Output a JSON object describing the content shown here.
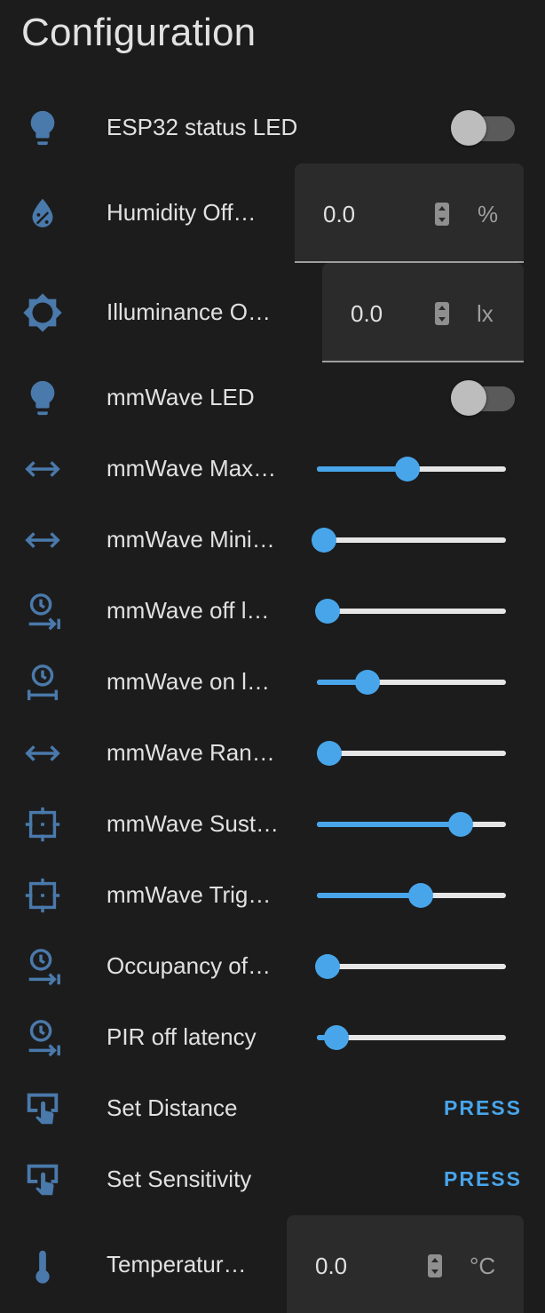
{
  "header": {
    "title": "Configuration"
  },
  "colors": {
    "background": "#1c1c1c",
    "accent": "#48a5ea",
    "icon": "#4a79ab",
    "text": "#e1e1e1"
  },
  "entities": {
    "esp32_led": {
      "label": "ESP32 status LED",
      "icon": "lightbulb-icon",
      "state": "off"
    },
    "humidity_offset": {
      "label": "Humidity Off…",
      "icon": "water-percent-icon",
      "value": "0.0",
      "unit": "%"
    },
    "illuminance_offset": {
      "label": "Illuminance O…",
      "icon": "brightness-icon",
      "value": "0.0",
      "unit": "lx"
    },
    "mmwave_led": {
      "label": "mmWave LED",
      "icon": "lightbulb-icon",
      "state": "off"
    },
    "mmwave_max": {
      "label": "mmWave Max…",
      "icon": "arrow-left-right-icon",
      "level": 0.48
    },
    "mmwave_min": {
      "label": "mmWave Mini…",
      "icon": "arrow-left-right-icon",
      "level": 0.02
    },
    "mmwave_off_latency": {
      "label": "mmWave off l…",
      "icon": "timer-arrow-icon",
      "level": 0.04
    },
    "mmwave_on_latency": {
      "label": "mmWave on l…",
      "icon": "timer-range-icon",
      "level": 0.26
    },
    "mmwave_range": {
      "label": "mmWave Ran…",
      "icon": "arrow-left-right-icon",
      "level": 0.05
    },
    "mmwave_sustain": {
      "label": "mmWave Sust…",
      "icon": "crosshair-box-icon",
      "level": 0.77
    },
    "mmwave_trigger": {
      "label": "mmWave Trig…",
      "icon": "crosshair-box-icon",
      "level": 0.55
    },
    "occupancy_off": {
      "label": "Occupancy of…",
      "icon": "timer-arrow-icon",
      "level": 0.04
    },
    "pir_off_latency": {
      "label": "PIR off latency",
      "icon": "timer-arrow-icon",
      "level": 0.09
    },
    "set_distance": {
      "label": "Set Distance",
      "icon": "gesture-tap-button-icon",
      "action": "PRESS"
    },
    "set_sensitivity": {
      "label": "Set Sensitivity",
      "icon": "gesture-tap-button-icon",
      "action": "PRESS"
    },
    "temperature_offset": {
      "label": "Temperatur…",
      "icon": "thermometer-icon",
      "value": "0.0",
      "unit": "°C"
    }
  }
}
